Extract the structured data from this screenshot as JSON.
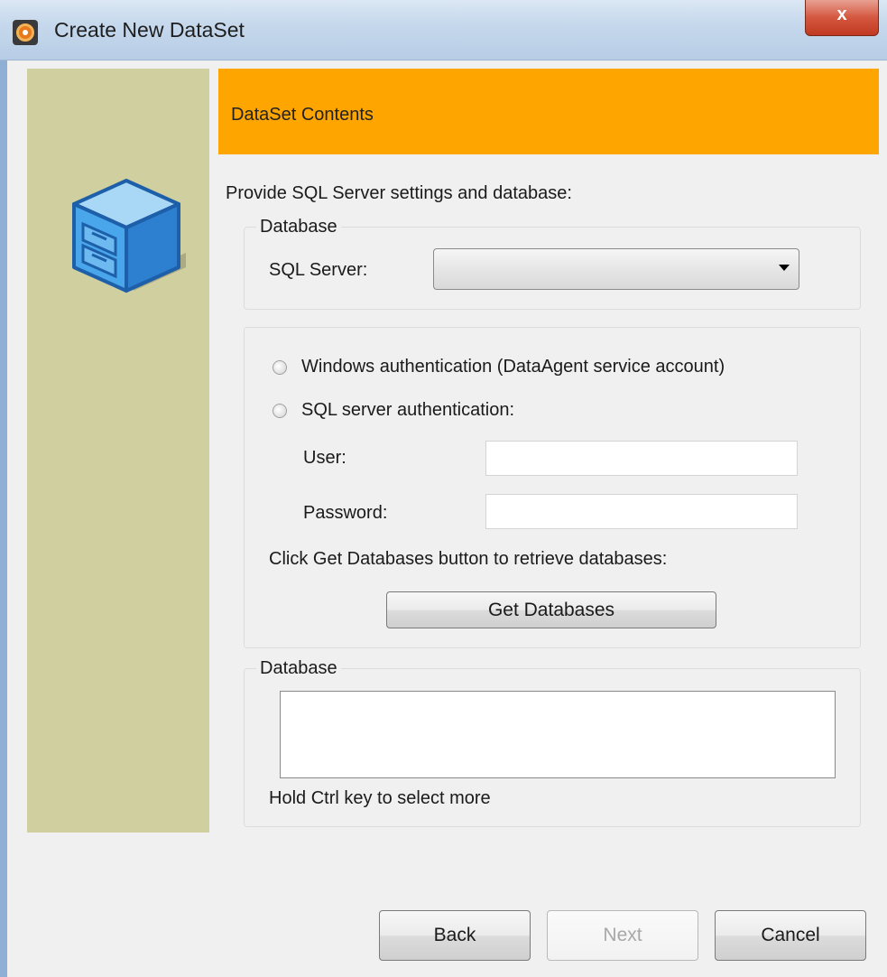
{
  "window": {
    "title": "Create New DataSet",
    "close_glyph": "x"
  },
  "sidebar": {
    "icon": "database-cube-icon"
  },
  "header": {
    "title": "DataSet Contents",
    "color": "#ffa500"
  },
  "intro_text": "Provide SQL Server settings and database:",
  "server_group": {
    "legend": "Database",
    "sql_server_label": "SQL Server:",
    "sql_server_value": ""
  },
  "auth_group": {
    "windows_auth_label": "Windows authentication (DataAgent service account)",
    "sql_auth_label": "SQL server authentication:",
    "user_label": "User:",
    "user_value": "",
    "password_label": "Password:",
    "password_value": "",
    "hint": "Click Get Databases button to retrieve databases:",
    "get_databases_label": "Get Databases"
  },
  "database_group": {
    "legend": "Database",
    "items": [],
    "hint": "Hold Ctrl key to select more"
  },
  "footer": {
    "back_label": "Back",
    "next_label": "Next",
    "cancel_label": "Cancel"
  }
}
